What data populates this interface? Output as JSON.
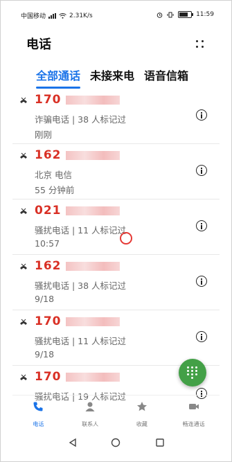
{
  "status_bar": {
    "carrier": "中国移动",
    "network_speed": "2.31K/s",
    "time": "11:59"
  },
  "header": {
    "title": "电话",
    "more_icon": "more-grid-icon"
  },
  "tabs": [
    {
      "label": "全部通话",
      "active": true
    },
    {
      "label": "未接来电",
      "active": false
    },
    {
      "label": "语音信箱",
      "active": false
    }
  ],
  "calls": [
    {
      "prefix": "170",
      "tag": "诈骗电话 | 38 人标记过",
      "time": "刚刚"
    },
    {
      "prefix": "162",
      "tag": "北京 电信",
      "time": "55 分钟前"
    },
    {
      "prefix": "021",
      "tag": "骚扰电话 | 11 人标记过",
      "time": "10:57"
    },
    {
      "prefix": "162",
      "tag": "骚扰电话 | 38 人标记过",
      "time": "9/18"
    },
    {
      "prefix": "170",
      "tag": "骚扰电话 | 11 人标记过",
      "time": "9/18"
    },
    {
      "prefix": "170",
      "tag": "骚扰电话 | 19 人标记过",
      "time": ""
    }
  ],
  "bottom_nav": [
    {
      "label": "电话",
      "icon": "phone-icon",
      "active": true
    },
    {
      "label": "联系人",
      "icon": "contacts-icon",
      "active": false
    },
    {
      "label": "收藏",
      "icon": "star-icon",
      "active": false
    },
    {
      "label": "畅连通话",
      "icon": "video-call-icon",
      "active": false
    }
  ],
  "colors": {
    "accent": "#1a73e8",
    "number_red": "#d93025",
    "fab_green": "#43a047"
  }
}
